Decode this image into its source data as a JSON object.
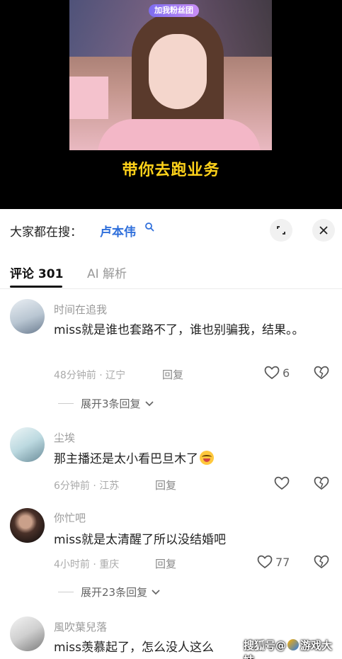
{
  "video": {
    "badge": "加我粉丝团",
    "subtitle": "带你去跑业务"
  },
  "search": {
    "prefix": "大家都在搜：",
    "keyword": "卢本伟",
    "icon": "search-icon"
  },
  "tabs": [
    {
      "label": "评论 301",
      "active": true
    },
    {
      "label": "AI 解析",
      "active": false
    }
  ],
  "comments": [
    {
      "username": "时间在追我",
      "text": "miss就是谁也套路不了，谁也别骗我，结果。。",
      "meta": "48分钟前 · 辽宁",
      "reply_label": "回复",
      "likes": "6",
      "expand": "展开3条回复"
    },
    {
      "username": "尘埃",
      "text": "那主播还是太小看巴旦木了",
      "meta": "6分钟前 · 江苏",
      "reply_label": "回复",
      "likes": "",
      "expand": ""
    },
    {
      "username": "你忙吧",
      "text": "miss就是太清醒了所以没结婚吧",
      "meta": "4小时前 · 重庆",
      "reply_label": "回复",
      "likes": "77",
      "expand": "展开23条回复"
    },
    {
      "username": "風吹葉兒落",
      "text": "miss羡慕起了，怎么没人这么",
      "meta": "",
      "reply_label": "",
      "likes": "",
      "expand": ""
    }
  ],
  "watermark": {
    "left": "搜狐号",
    "at": "@",
    "right": "游戏大妹"
  },
  "colors": {
    "subtitle": "#ffd21a",
    "keyword": "#2f6fdb",
    "badge": "#7c6cf0"
  }
}
